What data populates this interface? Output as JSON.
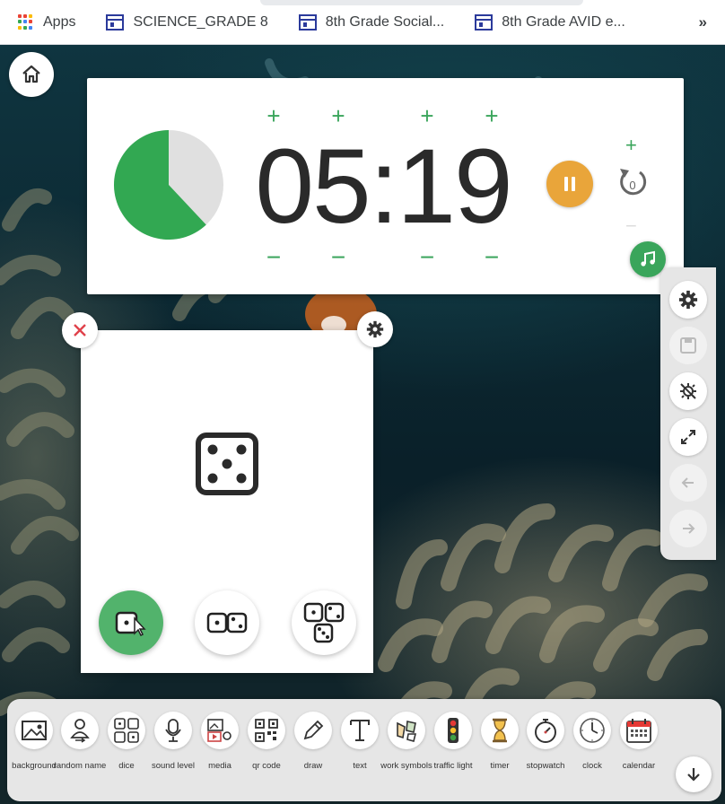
{
  "bookmarks": {
    "items": [
      {
        "label": "Apps",
        "icon": "apps-grid-icon"
      },
      {
        "label": "SCIENCE_GRADE 8",
        "icon": "site-icon"
      },
      {
        "label": "8th Grade Social...",
        "icon": "site-icon"
      },
      {
        "label": "8th Grade AVID e...",
        "icon": "site-icon"
      }
    ],
    "more": "»"
  },
  "timer": {
    "display": "05:19",
    "remaining_fraction": 0.62,
    "plus": "+",
    "minus": "−",
    "colors": {
      "elapsed": "#e0e0e0",
      "remaining": "#32a852",
      "pause": "#e9a53a",
      "accent": "#3aa55b"
    },
    "reset_count": "0"
  },
  "right_toolbar": [
    "gear-icon",
    "save-icon",
    "hide-icon",
    "fullscreen-icon",
    "back-arrow-icon",
    "forward-arrow-icon"
  ],
  "dice": {
    "current_face": 5,
    "options": [
      "one-die",
      "two-dice",
      "three-dice"
    ],
    "selected": "one-die"
  },
  "tools": [
    {
      "label": "background",
      "icon": "background-icon"
    },
    {
      "label": "random name",
      "icon": "random-name-icon"
    },
    {
      "label": "dice",
      "icon": "dice-icon"
    },
    {
      "label": "sound level",
      "icon": "microphone-icon"
    },
    {
      "label": "media",
      "icon": "media-icon"
    },
    {
      "label": "qr code",
      "icon": "qr-code-icon"
    },
    {
      "label": "draw",
      "icon": "pencil-icon"
    },
    {
      "label": "text",
      "icon": "text-icon"
    },
    {
      "label": "work symbols",
      "icon": "work-symbols-icon"
    },
    {
      "label": "traffic light",
      "icon": "traffic-light-icon"
    },
    {
      "label": "timer",
      "icon": "hourglass-icon"
    },
    {
      "label": "stopwatch",
      "icon": "stopwatch-icon"
    },
    {
      "label": "clock",
      "icon": "clock-icon"
    },
    {
      "label": "calendar",
      "icon": "calendar-icon"
    }
  ]
}
